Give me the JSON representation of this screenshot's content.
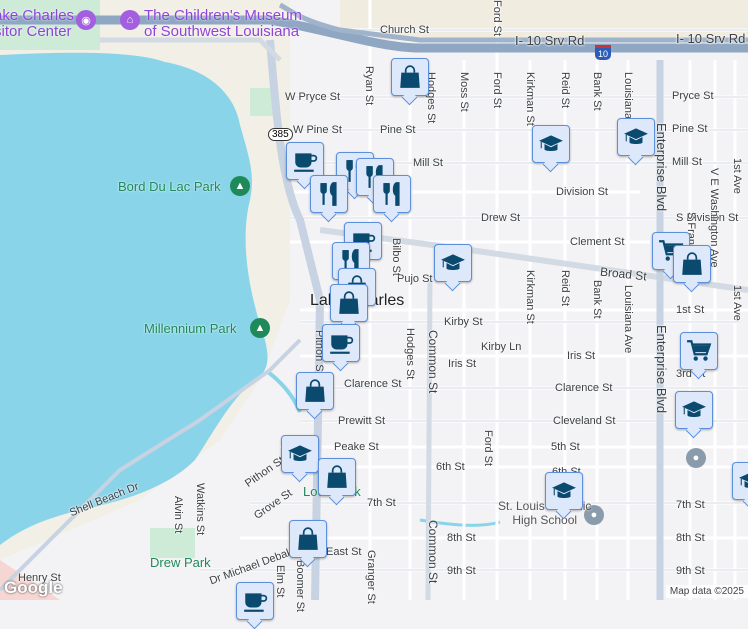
{
  "pois": {
    "visitor_center": "ake Charles\nsitor Center",
    "museum": "The Children's Museum\nof Southwest Louisiana"
  },
  "parks": [
    "Bord Du Lac Park",
    "Millennium Park",
    "Drew Park",
    "Lock Park"
  ],
  "city": "Lake Charles",
  "school_label": "St. Louis Catholic\nHigh School",
  "shields": {
    "state": "385",
    "interstate": "10"
  },
  "streets": [
    "Church St",
    "I- 10 Srv Rd",
    "I- 10 Srv Rd",
    "W Pryce St",
    "Pryce St",
    "W Pine St",
    "Pine St",
    "Pine St",
    "Mill St",
    "Mill St",
    "Division St",
    "S Division St",
    "Drew St",
    "Clement St",
    "Broad St",
    "Pujo St",
    "Kirby St",
    "Kirby Ln",
    "Iris St",
    "Iris St",
    "Clarence St",
    "Clarence St",
    "Prewitt St",
    "Cleveland St",
    "Peake St",
    "5th St",
    "6th St",
    "6th St",
    "7th St",
    "7th St",
    "8th St",
    "8th St",
    "9th St",
    "9th St",
    "1st St",
    "3rd St",
    "East St",
    "Henry St",
    "Shell Beach Dr",
    "Dr Michael Debakey Dr",
    "Pithon St",
    "Pithon St",
    "Grove St",
    "Ryan St",
    "Hodges St",
    "Hodges St",
    "Moss St",
    "Ford St",
    "Ford St",
    "Ford St",
    "Kirkman St",
    "Kirkman St",
    "Reid St",
    "Reid St",
    "Bank St",
    "Bank St",
    "Louisiana Ave",
    "Louisiana Ave",
    "Enterprise Blvd",
    "Enterprise Blvd",
    "V E Washington Ave",
    "S Franklin St",
    "1st Ave",
    "1st Ave",
    "Common St",
    "Common St",
    "Bilbo St",
    "Alvin St",
    "Watkins St",
    "Granger St",
    "Elm St",
    "Boomer St"
  ],
  "markers": [
    "shopping-bag",
    "school",
    "school",
    "coffee",
    "restaurant",
    "restaurant",
    "restaurant",
    "restaurant",
    "coffee",
    "restaurant",
    "shopping-bag",
    "shopping-bag",
    "coffee",
    "school",
    "shopping-cart",
    "shopping-bag",
    "shopping-cart",
    "school",
    "shopping-bag",
    "school",
    "shopping-bag",
    "school",
    "shopping-bag",
    "school",
    "coffee"
  ],
  "footer": {
    "logo": "Google",
    "attribution": "Map data ©2025"
  },
  "colors": {
    "water": "#8ad4ea",
    "land": "#f1efe6",
    "park": "#cdebd7",
    "highway": "#8fa7c3",
    "marker_bg": "#dde8fb",
    "marker_icon": "#0b4a6f"
  }
}
